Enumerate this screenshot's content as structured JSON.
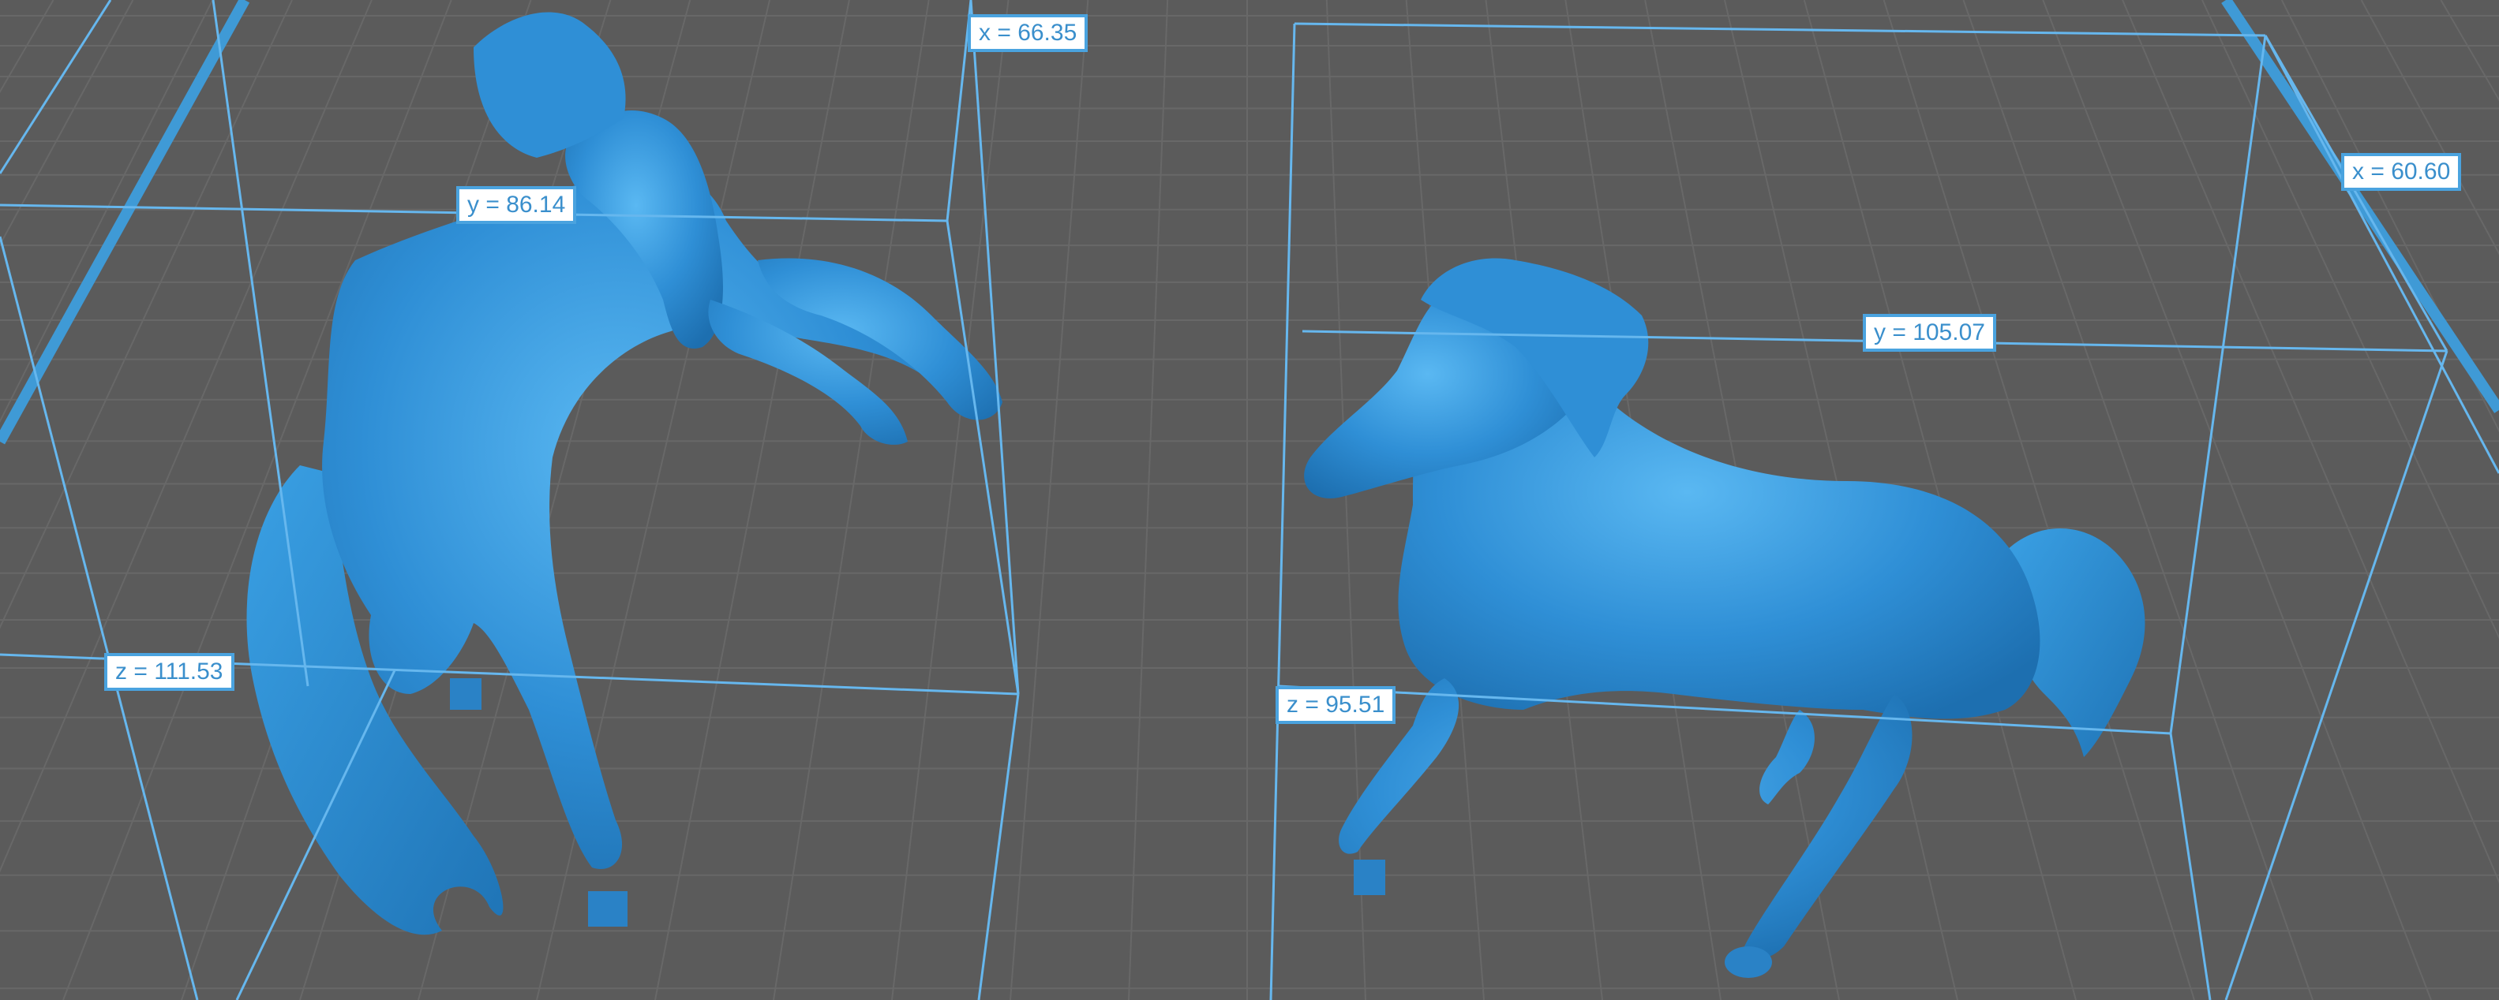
{
  "viewport": {
    "background_color": "#5b5b5b",
    "grid_line_color": "#686868",
    "build_plate_edge_color": "#3f9ad6",
    "bounding_box_color": "#66b7ee",
    "model_color": "#2f8fd6"
  },
  "models": [
    {
      "name": "rearing-horse",
      "dimensions": {
        "x_label": "x = 66.35",
        "y_label": "y = 86.14",
        "z_label": "z = 111.53"
      }
    },
    {
      "name": "walking-horse",
      "dimensions": {
        "x_label": "x = 60.60",
        "y_label": "y = 105.07",
        "z_label": "z = 95.51"
      }
    }
  ]
}
